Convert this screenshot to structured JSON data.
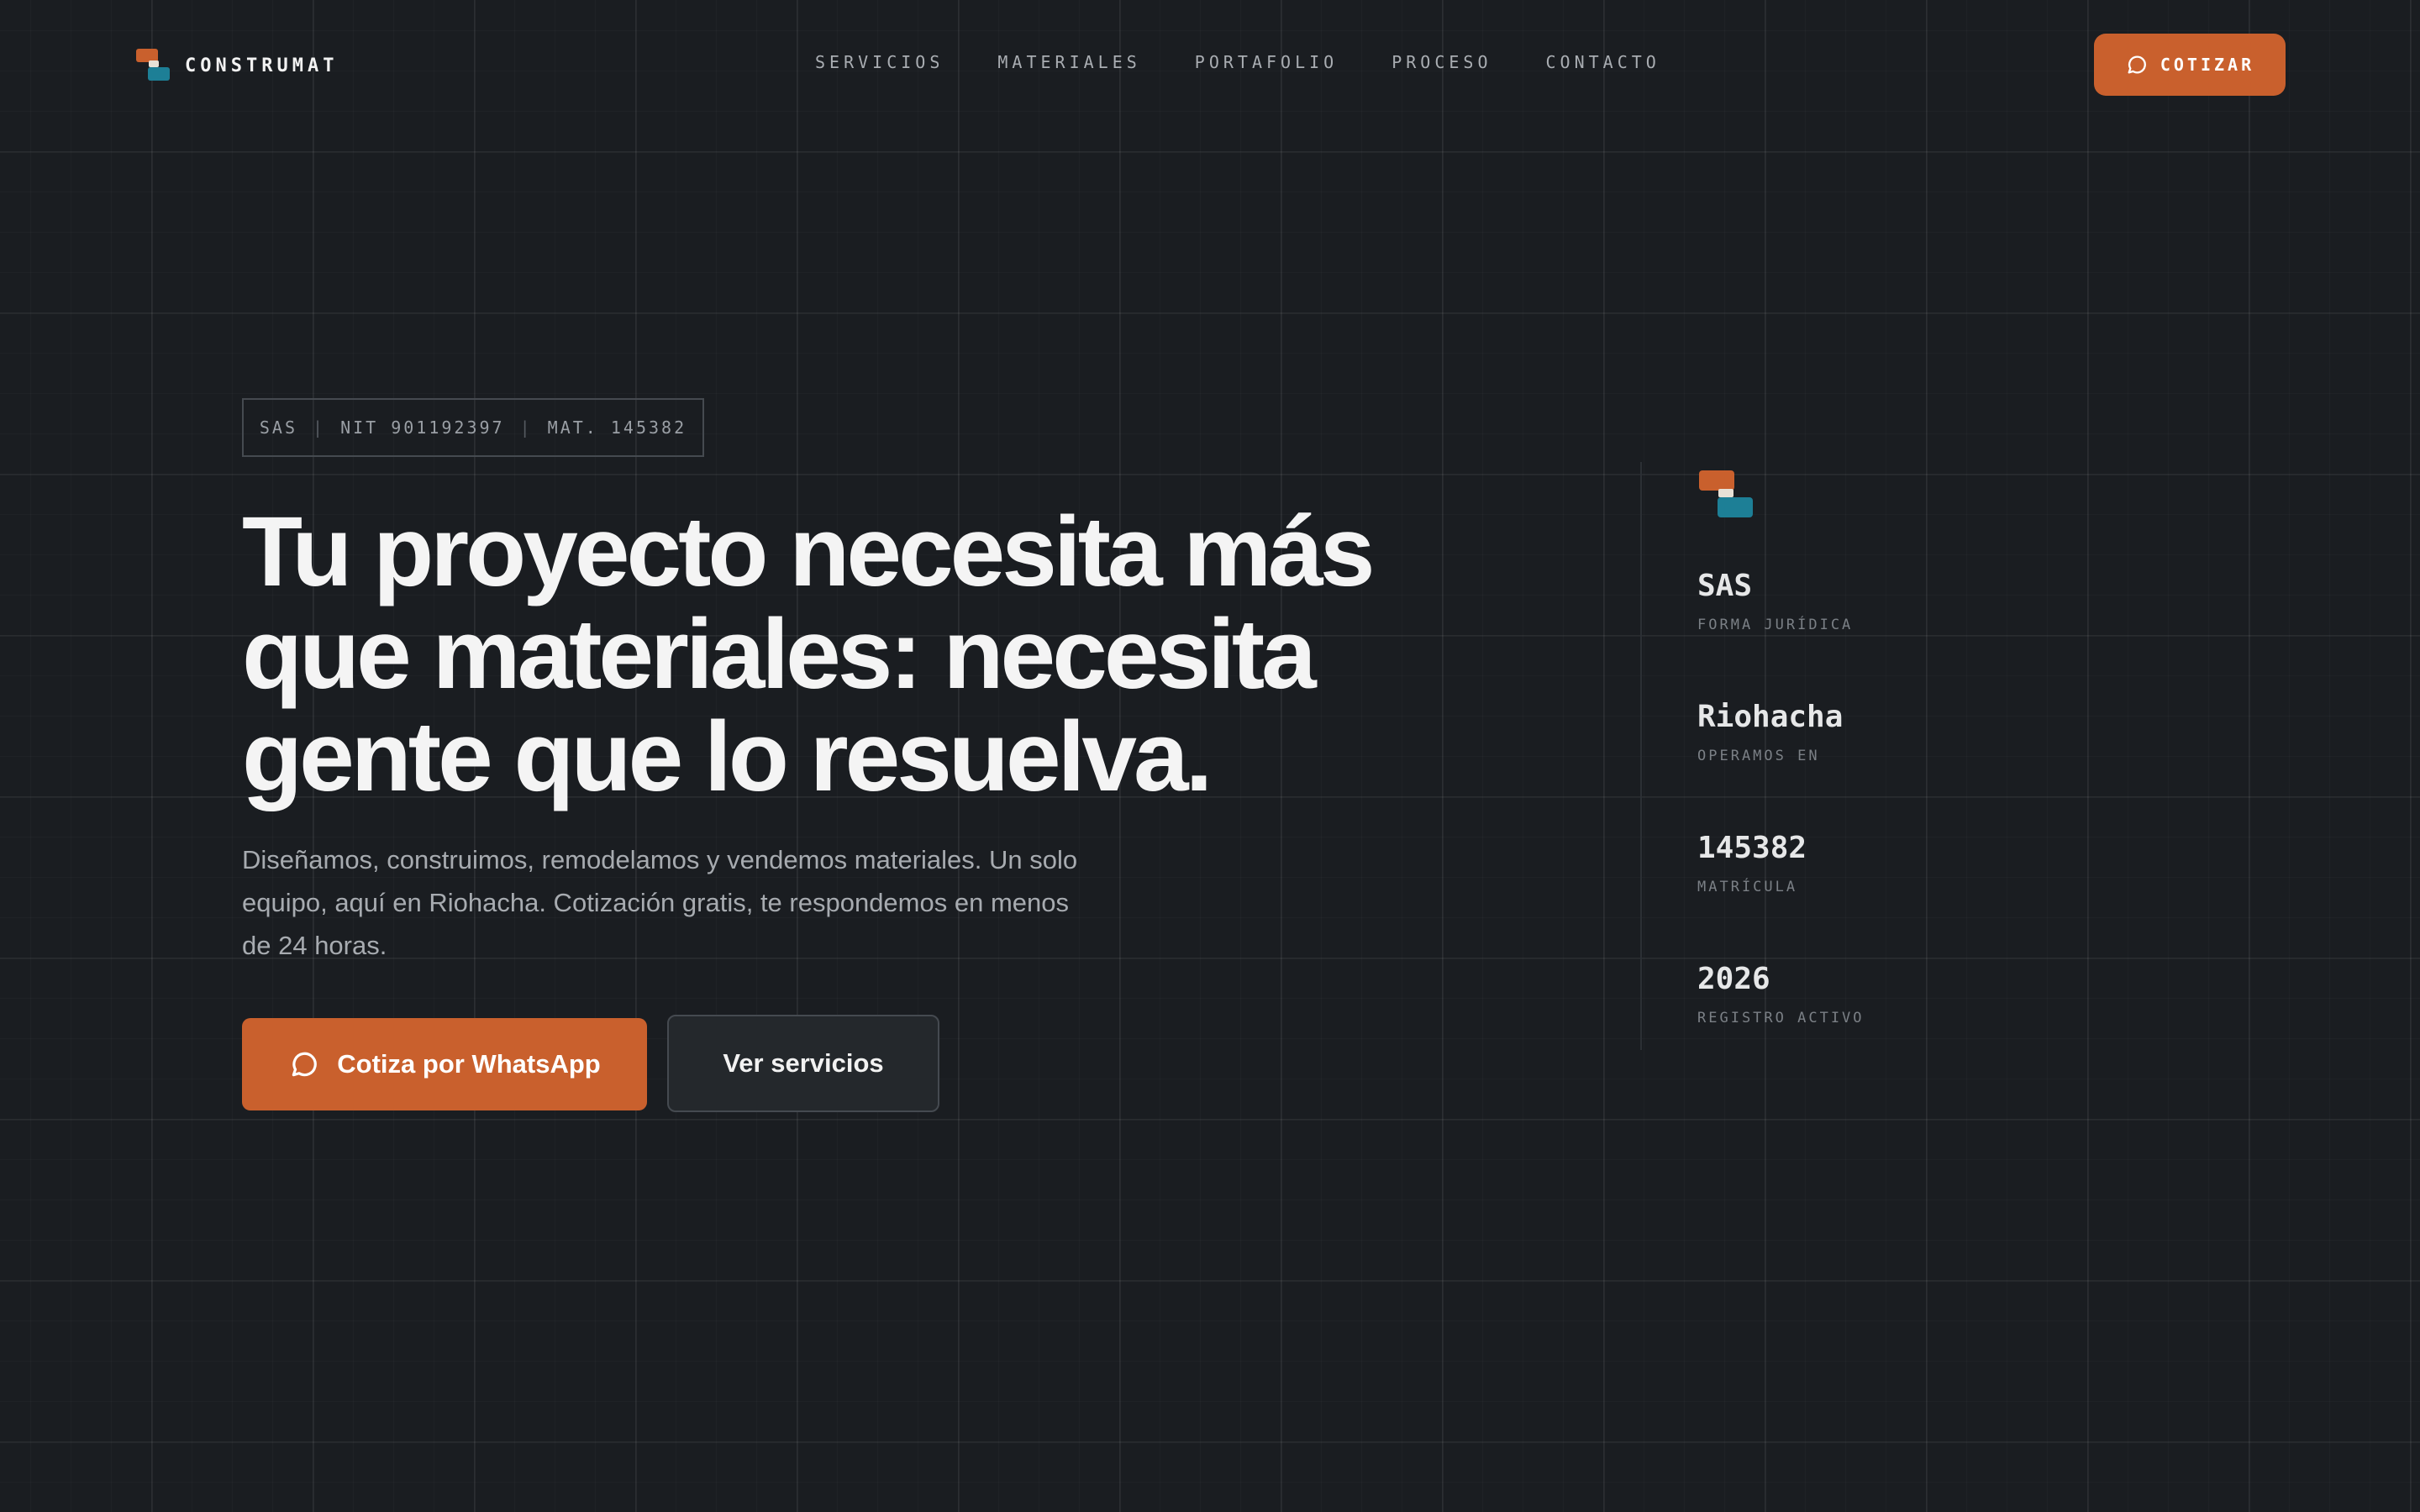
{
  "brand": {
    "name": "CONSTRUMAT"
  },
  "nav": {
    "links": [
      "SERVICIOS",
      "MATERIALES",
      "PORTAFOLIO",
      "PROCESO",
      "CONTACTO"
    ],
    "cta_label": "COTIZAR"
  },
  "hero": {
    "badge": {
      "part1": "SAS",
      "part2": "NIT 901192397",
      "part3": "MAT. 145382",
      "separator": "|"
    },
    "headline": "Tu proyecto necesita más que materiales: necesita gente que lo resuelva.",
    "subtitle": "Diseñamos, construimos, remodelamos y vendemos materiales. Un solo equipo, aquí en Riohacha. Cotización gratis, te respondemos en menos de 24 horas.",
    "primary_button": "Cotiza por WhatsApp",
    "secondary_button": "Ver servicios"
  },
  "stats": [
    {
      "value": "SAS",
      "label": "FORMA JURÍDICA"
    },
    {
      "value": "Riohacha",
      "label": "OPERAMOS EN"
    },
    {
      "value": "145382",
      "label": "MATRÍCULA"
    },
    {
      "value": "2026",
      "label": "REGISTRO ACTIVO"
    }
  ],
  "colors": {
    "background": "#1a1d21",
    "accent": "#c9602d",
    "brand_blue": "#1d7f96"
  },
  "icons": {
    "chat": "chat-bubble-icon"
  }
}
